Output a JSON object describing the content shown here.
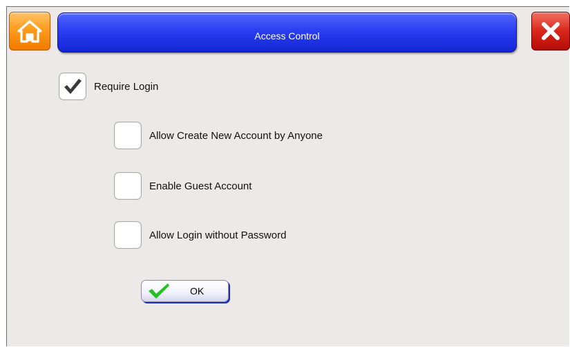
{
  "header": {
    "title": "Access Control",
    "home_icon": "home-icon",
    "close_icon": "close-icon",
    "title_bar_color": "#2a3ef0",
    "home_button_color": "#ff9c1e",
    "close_button_color": "#d9261b"
  },
  "options": [
    {
      "label": "Require Login",
      "checked": true
    },
    {
      "label": "Allow Create New Account by Anyone",
      "checked": false
    },
    {
      "label": "Enable Guest Account",
      "checked": false
    },
    {
      "label": "Allow Login without Password",
      "checked": false
    }
  ],
  "footer": {
    "ok_label": "OK",
    "ok_icon": "check-icon",
    "ok_check_color": "#22c21e"
  }
}
